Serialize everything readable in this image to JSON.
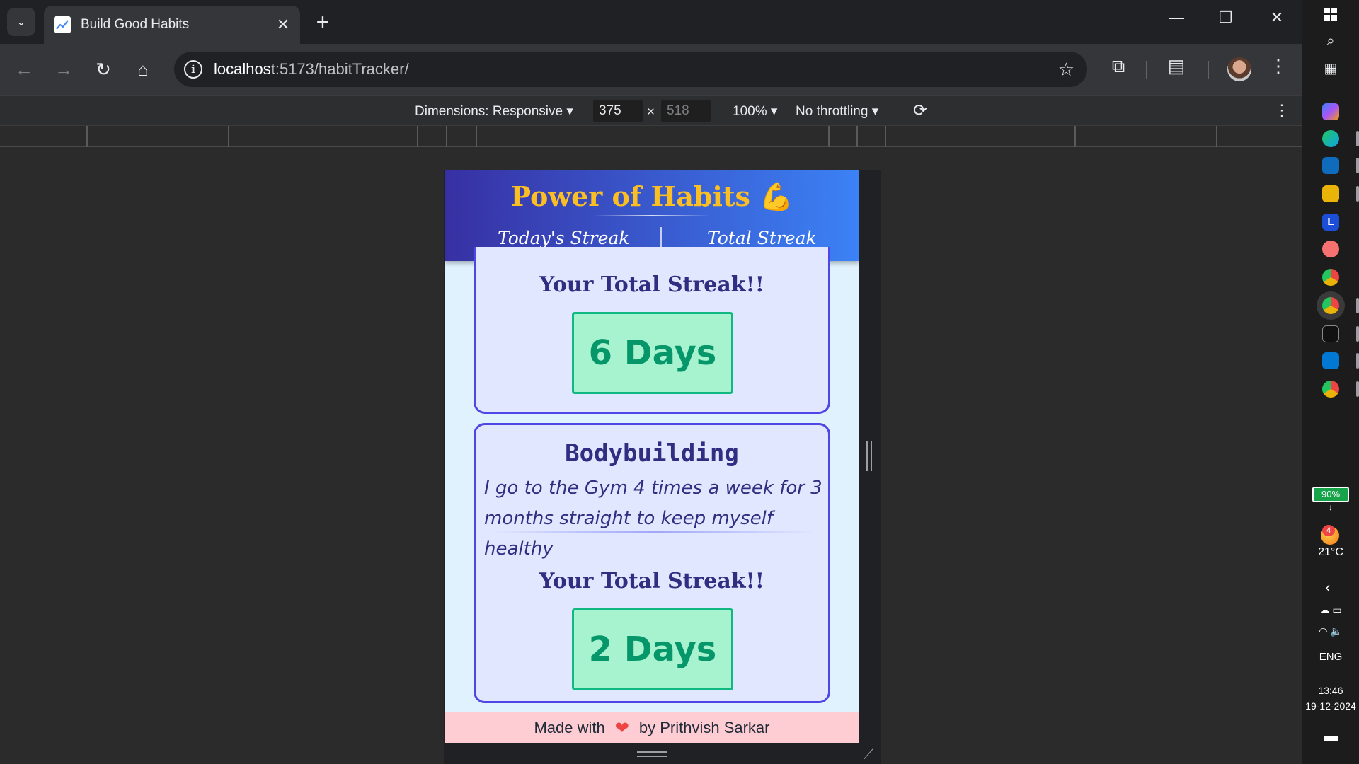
{
  "browser": {
    "tab_title": "Build Good Habits",
    "url_host": "localhost",
    "url_path": ":5173/habitTracker/"
  },
  "devtools": {
    "dimensions_label": "Dimensions: Responsive",
    "width_value": "375",
    "times_symbol": "×",
    "height_value": "518",
    "zoom_label": "100%",
    "throttling_label": "No throttling"
  },
  "app": {
    "title": "Power of Habits 💪",
    "nav": {
      "todays_streak": "Today's Streak",
      "total_streak": "Total Streak"
    },
    "cards": [
      {
        "streak_heading": "Your Total Streak!!",
        "days_label": "6 Days"
      },
      {
        "habit_name": "Bodybuilding",
        "habit_description": "I go to the Gym 4 times a week for 3 months straight to keep myself healthy",
        "streak_heading": "Your Total Streak!!",
        "days_label": "2 Days"
      }
    ],
    "footer": {
      "prefix": "Made with",
      "heart": "❤",
      "suffix": "by Prithvish Sarkar"
    }
  },
  "system": {
    "battery_percent": "90%",
    "weather_badge": "4",
    "temperature": "21°C",
    "language": "ENG",
    "time": "13:46",
    "date": "19-12-2024"
  },
  "colors": {
    "header_gradient_start": "#3730a3",
    "header_gradient_end": "#3b82f6",
    "title_gold": "#fbbf24",
    "card_border": "#4f46e5",
    "days_green": "#10b981",
    "footer_pink": "#fecdd3"
  }
}
